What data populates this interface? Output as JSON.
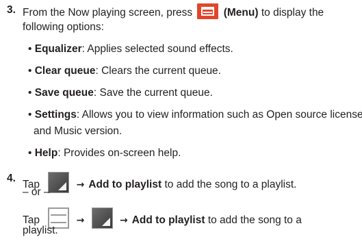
{
  "step3": {
    "number": "3.",
    "line1_pre": "From the Now playing screen, press",
    "menu_label": "(Menu)",
    "line1_post": "to display the",
    "line2": "following options:",
    "bullets": [
      {
        "term": "Equalizer",
        "desc": ": Applies selected sound effects."
      },
      {
        "term": "Clear queue",
        "desc": ": Clears the current queue."
      },
      {
        "term": "Save queue",
        "desc": ": Save the current queue."
      },
      {
        "term": "Settings",
        "desc": ": Allows you to view information such as Open source licenses,",
        "desc2": "and Music version."
      },
      {
        "term": "Help",
        "desc": ": Provides on-screen help."
      }
    ]
  },
  "step4": {
    "number": "4.",
    "tap": "Tap",
    "add_to_playlist": "Add to playlist",
    "line1_post": "to add the song to a playlist.",
    "or": "– or –",
    "tap2": "Tap",
    "line3_post": "to add the song to a",
    "line4": "playlist."
  },
  "icons": {
    "menu": "menu-icon",
    "overflow": "overflow-icon",
    "list": "list-icon",
    "accent_color": "#e1462c"
  }
}
